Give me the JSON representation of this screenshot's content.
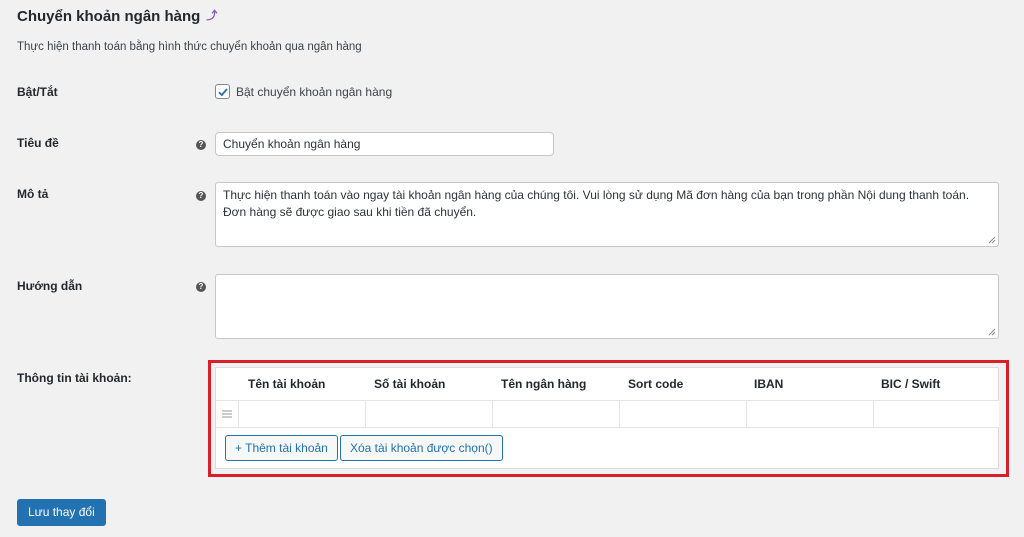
{
  "header": {
    "title": "Chuyển khoản ngân hàng",
    "description": "Thực hiện thanh toán bằng hình thức chuyển khoản qua ngân hàng"
  },
  "fields": {
    "enable": {
      "label": "Bật/Tắt",
      "checkbox_label": "Bật chuyển khoản ngân hàng",
      "checked": true
    },
    "title": {
      "label": "Tiêu đề",
      "value": "Chuyển khoản ngân hàng"
    },
    "description": {
      "label": "Mô tả",
      "value": "Thực hiện thanh toán vào ngay tài khoản ngân hàng của chúng tôi. Vui lòng sử dụng Mã đơn hàng của bạn trong phần Nội dung thanh toán. Đơn hàng sẽ được giao sau khi tiền đã chuyển."
    },
    "instructions": {
      "label": "Hướng dẫn",
      "value": ""
    },
    "accounts": {
      "label": "Thông tin tài khoản:",
      "columns": [
        "Tên tài khoản",
        "Số tài khoản",
        "Tên ngân hàng",
        "Sort code",
        "IBAN",
        "BIC / Swift"
      ],
      "add_button": "+ Thêm tài khoản",
      "remove_button": "Xóa tài khoản được chọn()"
    }
  },
  "footer": {
    "save_button": "Lưu thay đổi"
  },
  "colors": {
    "primary": "#2271b1",
    "highlight": "#d9202a",
    "background": "#f1f1f1"
  }
}
